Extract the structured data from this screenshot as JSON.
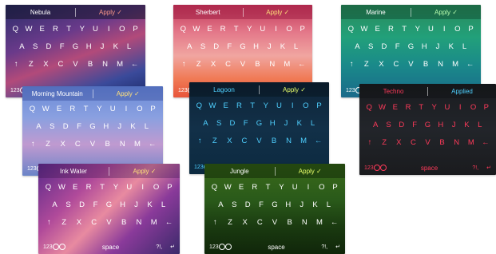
{
  "keyboards": [
    {
      "name": "Nebula",
      "apply": "Apply ✓",
      "applyColor": "#ff9a8a",
      "textColor": "#ffffff",
      "bg": "linear-gradient(160deg,#2a2d6b 0%,#6a3a8a 35%,#b24a7a 55%,#3a4a9a 80%,#1c2a6a 100%)"
    },
    {
      "name": "Sherbert",
      "apply": "Apply ✓",
      "applyColor": "#ffe07a",
      "textColor": "#ffffff",
      "bg": "linear-gradient(180deg,#c2395a 0%,#e4798a 30%,#f0a5a0 55%,#f07a55 80%,#e8553a 100%)"
    },
    {
      "name": "Marine",
      "apply": "Apply ✓",
      "applyColor": "#b8ffb0",
      "textColor": "#ffffff",
      "bg": "linear-gradient(180deg,#2a8a5a 0%,#22a07a 35%,#1a8a8a 65%,#1a6a8a 100%)"
    },
    {
      "name": "Morning Mountain",
      "apply": "Apply ✓",
      "applyColor": "#ffe07a",
      "textColor": "#ffffff",
      "bg": "linear-gradient(180deg,#6a8ad8 0%,#8aa0e0 35%,#c09ad0 65%,#6a84c8 100%)"
    },
    {
      "name": "Lagoon",
      "apply": "Apply ✓",
      "applyColor": "#e8ff6a",
      "textColor": "#4fd0ff",
      "bg": "linear-gradient(180deg,#0e2438 0%,#123048 50%,#0c2a40 100%)"
    },
    {
      "name": "Techno",
      "apply": "Applied",
      "applyColor": "#4fd0ff",
      "textColor": "#ff3a5a",
      "bg": "linear-gradient(180deg,#1a1c20 0%,#22252a 50%,#1a1b1e 100%)"
    },
    {
      "name": "Ink Water",
      "apply": "Apply ✓",
      "applyColor": "#ffe07a",
      "textColor": "#ffffff",
      "bg": "linear-gradient(135deg,#5a2a8a 0%,#b04a9a 30%,#e88aa0 50%,#8a3a9a 70%,#3a2a6a 100%)"
    },
    {
      "name": "Jungle",
      "apply": "Apply ✓",
      "applyColor": "#e8ff6a",
      "textColor": "#ffffff",
      "bg": "linear-gradient(180deg,#3a6a1a 0%,#2a5a1a 40%,#1a3a10 70%,#10260a 100%)"
    }
  ],
  "rows": [
    [
      "Q",
      "W",
      "E",
      "R",
      "T",
      "Y",
      "U",
      "I",
      "O",
      "P"
    ],
    [
      "A",
      "S",
      "D",
      "F",
      "G",
      "H",
      "J",
      "K",
      "L"
    ],
    [
      "↑",
      "Z",
      "X",
      "C",
      "V",
      "B",
      "N",
      "M",
      "←"
    ]
  ],
  "fnRow": {
    "num": "123",
    "space": "space",
    "punct": "?!,",
    "enter": "↵"
  }
}
